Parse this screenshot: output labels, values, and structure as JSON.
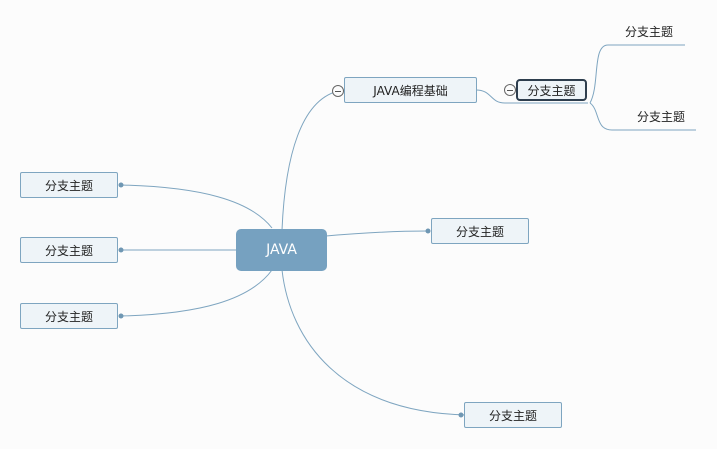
{
  "mindmap": {
    "central": "JAVA",
    "branch_main": "JAVA编程基础",
    "branch_main_child": "分支主题",
    "sub_topics": [
      "分支主题",
      "分支主题"
    ],
    "left_topics": [
      "分支主题",
      "分支主题",
      "分支主题"
    ],
    "right_topics": [
      "分支主题",
      "分支主题"
    ]
  },
  "colors": {
    "line": "#7ea5c0",
    "central_fill": "#76a1c0",
    "topic_fill": "#eef4f8",
    "selected_border": "#2e3e4e",
    "background": "#fcfcfc"
  },
  "icons": [
    "collapse-minus-icon"
  ]
}
